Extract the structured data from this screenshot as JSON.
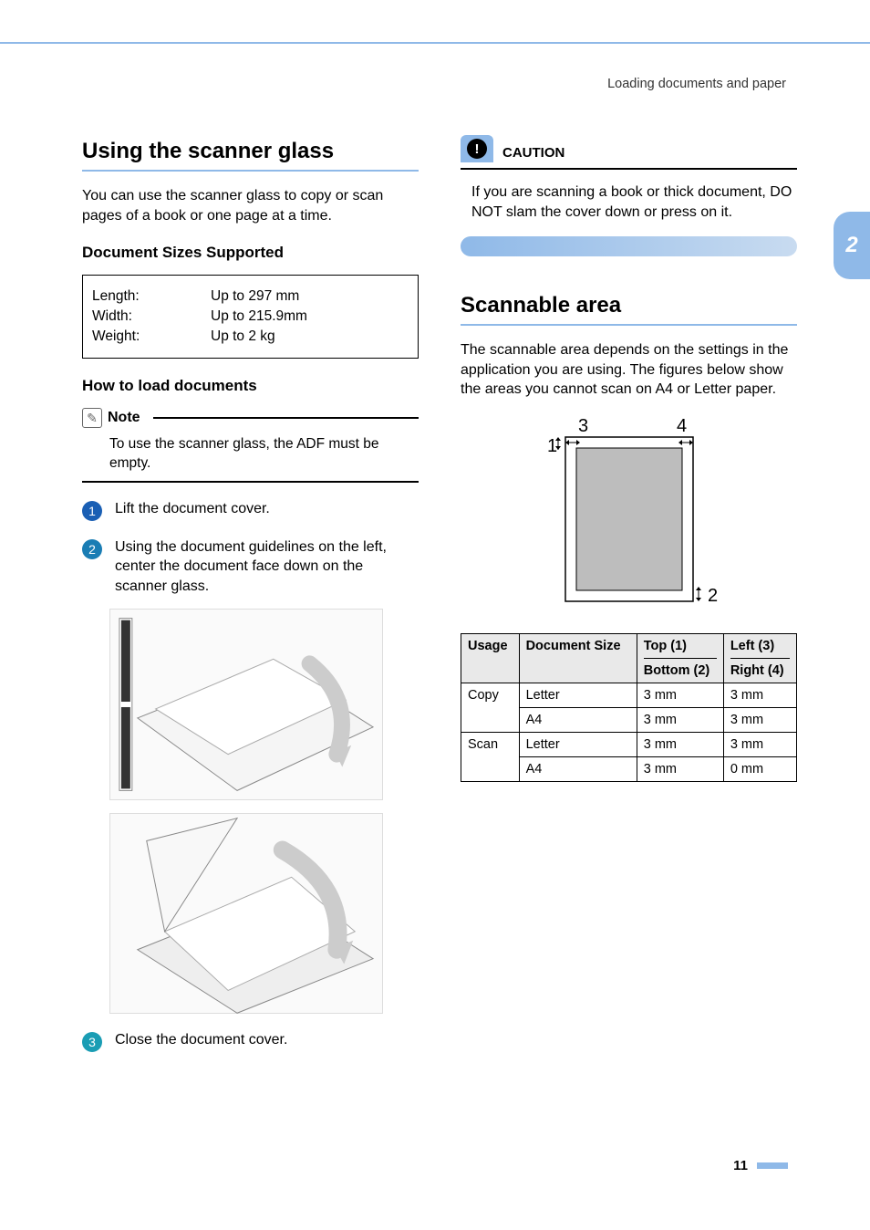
{
  "header_label": "Loading documents and paper",
  "chapter_tab": "2",
  "page_number": "11",
  "left": {
    "section_title": "Using the scanner glass",
    "intro": "You can use the scanner glass to copy or scan pages of a book or one page at a time.",
    "sizes_heading": "Document Sizes Supported",
    "sizes": {
      "length_label": "Length:",
      "length_value": "Up to 297 mm",
      "width_label": "Width:",
      "width_value": "Up to 215.9mm",
      "weight_label": "Weight:",
      "weight_value": "Up to 2 kg"
    },
    "howto_heading": "How to load documents",
    "note_title": "Note",
    "note_text": "To use the scanner glass, the ADF must be empty.",
    "step1": "Lift the document cover.",
    "step2": "Using the document guidelines on the left, center the document face down on the scanner glass.",
    "step3": "Close the document cover."
  },
  "right": {
    "caution_title": "CAUTION",
    "caution_text": "If you are scanning a book or thick document, DO NOT slam the cover down or press on it.",
    "section_title": "Scannable area",
    "intro": "The scannable area depends on the settings in the application you are using. The figures below show the areas you cannot scan on A4 or Letter paper.",
    "diagram_labels": {
      "n1": "1",
      "n2": "2",
      "n3": "3",
      "n4": "4"
    },
    "table": {
      "h_usage": "Usage",
      "h_docsize": "Document Size",
      "h_top": "Top (1)",
      "h_bottom": "Bottom (2)",
      "h_left": "Left (3)",
      "h_right": "Right (4)",
      "rows": [
        {
          "usage": "Copy",
          "sizes": [
            {
              "size": "Letter",
              "tb": "3 mm",
              "lr": "3 mm"
            },
            {
              "size": "A4",
              "tb": "3 mm",
              "lr": "3 mm"
            }
          ]
        },
        {
          "usage": "Scan",
          "sizes": [
            {
              "size": "Letter",
              "tb": "3 mm",
              "lr": "3 mm"
            },
            {
              "size": "A4",
              "tb": "3 mm",
              "lr": "0 mm"
            }
          ]
        }
      ]
    }
  }
}
